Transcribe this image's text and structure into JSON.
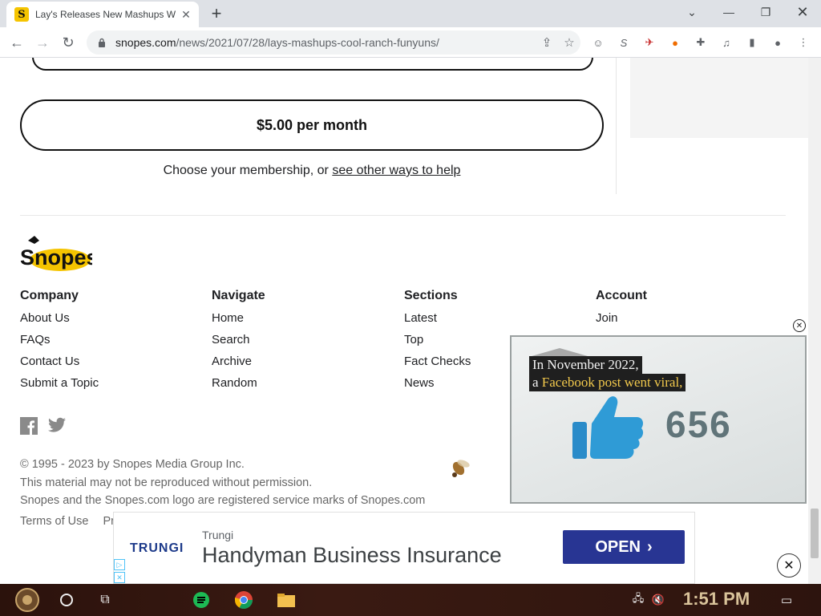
{
  "browser": {
    "tab_title": "Lay's Releases New Mashups W",
    "url_domain": "snopes.com",
    "url_path": "/news/2021/07/28/lays-mashups-cool-ranch-funyuns/"
  },
  "membership": {
    "price_label": "$5.00 per month",
    "choose_text": "Choose your membership, or",
    "help_link": "see other ways to help"
  },
  "logo_text": "Snopes",
  "footer": {
    "company": {
      "title": "Company",
      "links": [
        "About Us",
        "FAQs",
        "Contact Us",
        "Submit a Topic"
      ]
    },
    "navigate": {
      "title": "Navigate",
      "links": [
        "Home",
        "Search",
        "Archive",
        "Random"
      ]
    },
    "sections": {
      "title": "Sections",
      "links": [
        "Latest",
        "Top",
        "Fact Checks",
        "News"
      ]
    },
    "account": {
      "title": "Account",
      "links": [
        "Join"
      ]
    },
    "copyright": "© 1995 - 2023 by Snopes Media Group Inc.",
    "permission": "This material may not be reproduced without permission.",
    "trademark": "Snopes and the Snopes.com logo are registered service marks of Snopes.com",
    "terms": "Terms of Use",
    "privacy_partial": "Pr"
  },
  "video": {
    "caption_line1": "In November 2022,",
    "caption_line2_a": "a",
    "caption_line2_b": "Facebook post went viral,",
    "like_count": "656"
  },
  "ad": {
    "brand": "TRUNGI",
    "advertiser": "Trungi",
    "headline": "Handyman Business Insurance",
    "cta": "OPEN"
  },
  "taskbar": {
    "time": "1:51 PM"
  },
  "colors": {
    "ad_button": "#283593",
    "brand_yellow": "#f5c400"
  }
}
